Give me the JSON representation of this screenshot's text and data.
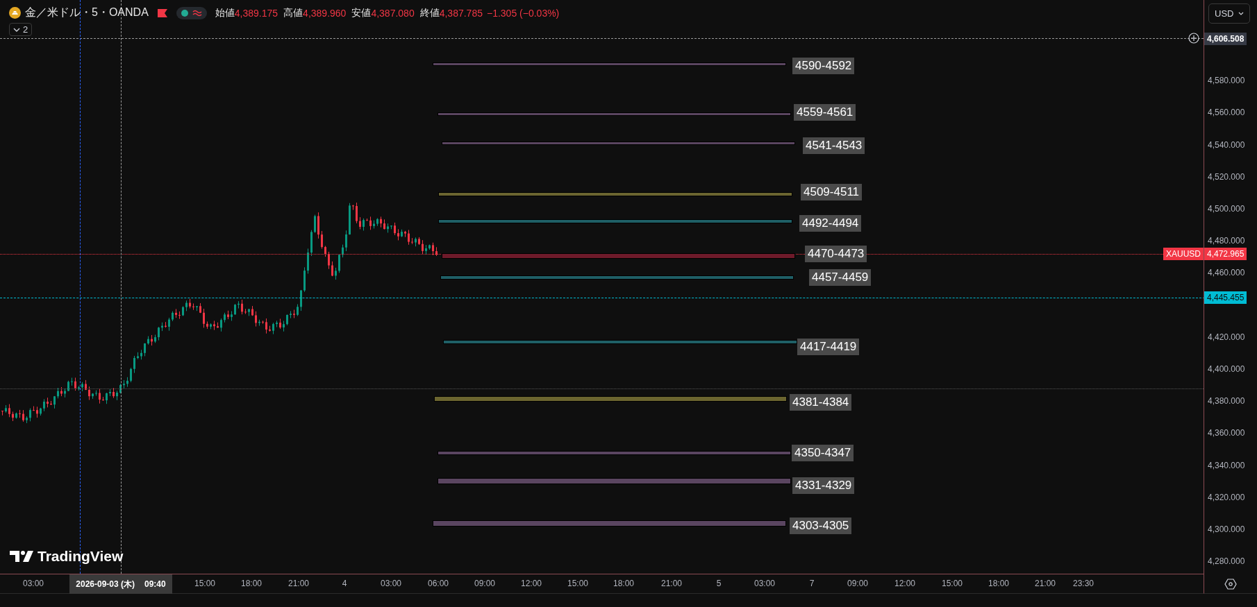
{
  "symbol_header": {
    "title": "金／米ドル・5・OANDA",
    "ohlc": [
      {
        "label": "始値",
        "value": "4,389.175"
      },
      {
        "label": "高値",
        "value": "4,389.960"
      },
      {
        "label": "安値",
        "value": "4,387.080"
      },
      {
        "label": "終値",
        "value": "4,387.785"
      }
    ],
    "change": "−1.305 (−0.03%)",
    "indicator_count": "2"
  },
  "chart": {
    "zones": [
      {
        "label": "4590-4592",
        "color": "#5a4560"
      },
      {
        "label": "4559-4561",
        "color": "#5a4560"
      },
      {
        "label": "4541-4543",
        "color": "#5a4560"
      },
      {
        "label": "4509-4511",
        "color": "#6b6530"
      },
      {
        "label": "4492-4494",
        "color": "#1f5f66"
      },
      {
        "label": "4470-4473",
        "color": "#6e1a2a"
      },
      {
        "label": "4457-4459",
        "color": "#1f5f66"
      },
      {
        "label": "4417-4419",
        "color": "#1f5f66"
      },
      {
        "label": "4381-4384",
        "color": "#6b6530"
      },
      {
        "label": "4350-4347",
        "color": "#5a4560"
      },
      {
        "label": "4331-4329",
        "color": "#5a4560"
      },
      {
        "label": "4303-4305",
        "color": "#5a4560"
      }
    ],
    "branding": "TradingView"
  },
  "price_axis": {
    "currency": "USD",
    "ticks": [
      "4,580.000",
      "4,560.000",
      "4,540.000",
      "4,520.000",
      "4,500.000",
      "4,480.000",
      "4,460.000",
      "4,420.000",
      "4,400.000",
      "4,380.000",
      "4,360.000",
      "4,340.000",
      "4,320.000",
      "4,300.000",
      "4,280.000"
    ],
    "crosshair_price": "4,606.508",
    "symbol_tag": "XAUUSD",
    "last_price": "4,472.965",
    "marker_price": "4,445.455"
  },
  "time_axis": {
    "ticks": [
      "03:00",
      "15:00",
      "18:00",
      "21:00",
      "4",
      "03:00",
      "06:00",
      "09:00",
      "12:00",
      "15:00",
      "18:00",
      "21:00",
      "5",
      "03:00",
      "7",
      "09:00",
      "12:00",
      "15:00",
      "18:00",
      "21:00",
      "23:30"
    ],
    "crosshair_date": "2026-09-03 (木)",
    "crosshair_time": "09:40"
  }
}
